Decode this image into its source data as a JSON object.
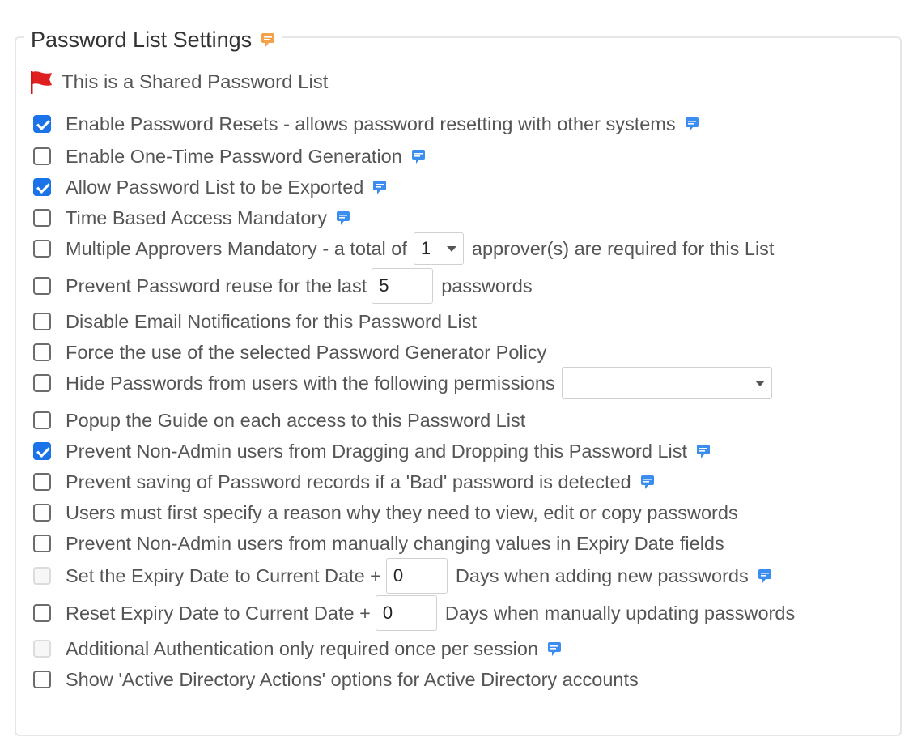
{
  "fieldset": {
    "title": "Password List Settings"
  },
  "shared": {
    "text": "This is a Shared Password List",
    "icon": "red-flag-icon"
  },
  "colors": {
    "accent": "#1a73e8",
    "flag": "#e02020",
    "help_blue": "#3b8ef0",
    "help_orange": "#f5a04a"
  },
  "options": [
    {
      "checked": true,
      "label": "Enable Password Resets - allows password resetting with other systems",
      "help": true
    },
    {
      "checked": false,
      "label": "Enable One-Time Password Generation",
      "help": true
    },
    {
      "checked": true,
      "label": "Allow Password List to be Exported",
      "help": true
    },
    {
      "checked": false,
      "label": "Time Based Access Mandatory",
      "help": true
    },
    {
      "checked": false,
      "label": "Multiple Approvers Mandatory - a total of",
      "select_value": "1",
      "label_after": "approver(s) are required for this List"
    },
    {
      "checked": false,
      "label": "Prevent Password reuse for the last",
      "input_value": "5",
      "label_after": "passwords"
    },
    {
      "checked": false,
      "label": "Disable Email Notifications for this Password List"
    },
    {
      "checked": false,
      "label": "Force the use of the selected Password Generator Policy"
    },
    {
      "checked": false,
      "label": "Hide Passwords from users with the following permissions",
      "select_value": ""
    },
    {
      "checked": false,
      "label": "Popup the Guide on each access to this Password List"
    },
    {
      "checked": true,
      "label": "Prevent Non-Admin users from Dragging and Dropping this Password List",
      "help": true
    },
    {
      "checked": false,
      "label": "Prevent saving of Password records if a 'Bad' password is detected",
      "help": true
    },
    {
      "checked": false,
      "label": "Users must first specify a reason why they need to view, edit or copy passwords"
    },
    {
      "checked": false,
      "label": "Prevent Non-Admin users from manually changing values in Expiry Date fields"
    },
    {
      "checked": false,
      "disabled": true,
      "label": "Set the Expiry Date to Current Date +",
      "input_value": "0",
      "label_after": "Days when adding new passwords",
      "help": true
    },
    {
      "checked": false,
      "label": "Reset Expiry Date to Current Date +",
      "input_value": "0",
      "label_after": "Days when manually updating passwords"
    },
    {
      "checked": false,
      "disabled": true,
      "label": "Additional Authentication only required once per session",
      "help": true
    },
    {
      "checked": false,
      "label": "Show 'Active Directory Actions' options for Active Directory accounts"
    }
  ]
}
